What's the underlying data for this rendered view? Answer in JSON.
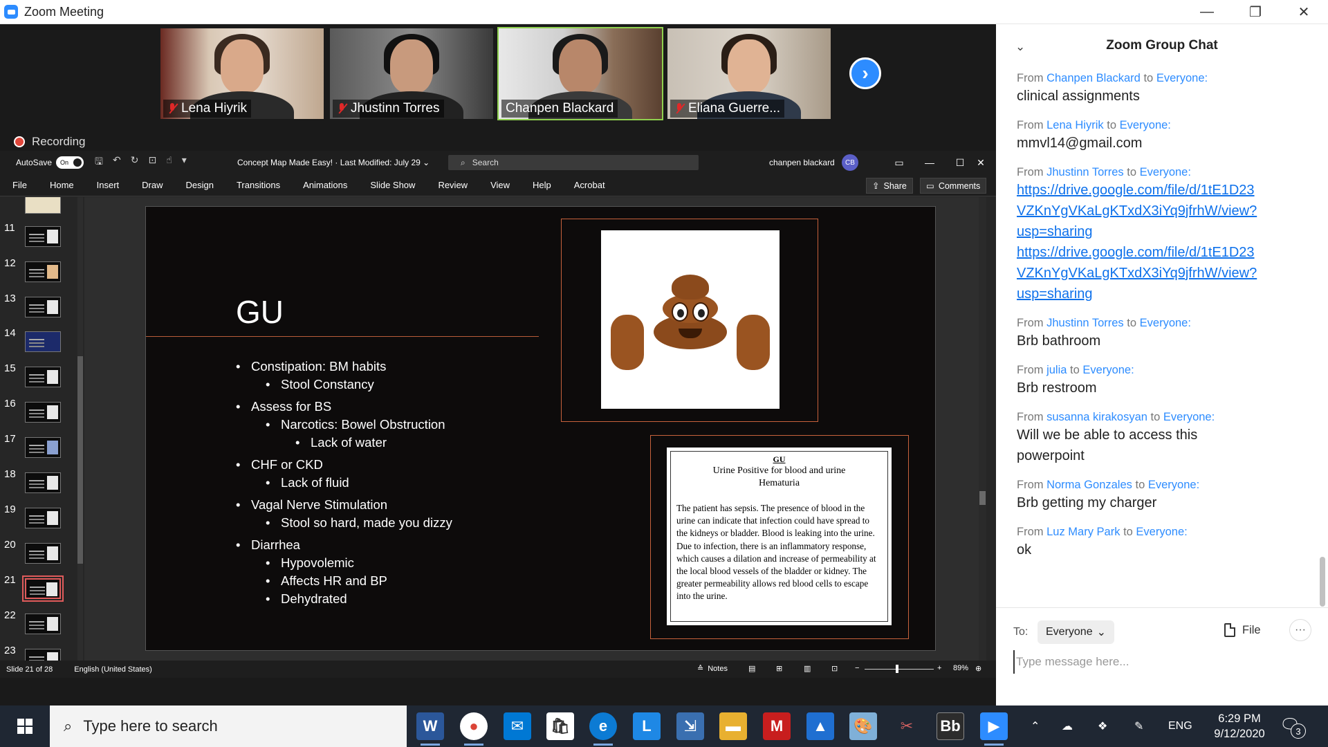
{
  "zoom_window": {
    "title": "Zoom Meeting",
    "recording_label": "Recording"
  },
  "participants": [
    {
      "name": "Lena Hiyrik",
      "muted": true
    },
    {
      "name": "Jhustinn Torres",
      "muted": true
    },
    {
      "name": "Chanpen Blackard",
      "muted": false,
      "active_speaker": true
    },
    {
      "name": "Eliana Guerre...",
      "muted": true
    }
  ],
  "powerpoint": {
    "autosave_label": "AutoSave",
    "autosave_state": "On",
    "doc_title": "Concept Map Made Easy! · Last Modified: July 29 ⌄",
    "search_placeholder": "Search",
    "user_name": "chanpen blackard",
    "user_initials": "CB",
    "ribbon_tabs": [
      "File",
      "Home",
      "Insert",
      "Draw",
      "Design",
      "Transitions",
      "Animations",
      "Slide Show",
      "Review",
      "View",
      "Help",
      "Acrobat"
    ],
    "share_label": "Share",
    "comments_label": "Comments",
    "thumbnails": [
      "11",
      "12",
      "13",
      "14",
      "15",
      "16",
      "17",
      "18",
      "19",
      "20",
      "21",
      "22",
      "23"
    ],
    "selected_slide": "21",
    "status": {
      "slide_info": "Slide 21 of 28",
      "language": "English (United States)",
      "notes_label": "Notes",
      "zoom_level": "89%"
    }
  },
  "slide": {
    "title": "GU",
    "bullets": [
      {
        "level": 1,
        "text": "Constipation: BM habits"
      },
      {
        "level": 2,
        "text": "Stool Constancy"
      },
      {
        "level": 1,
        "text": "Assess for BS"
      },
      {
        "level": 2,
        "text": "Narcotics: Bowel Obstruction"
      },
      {
        "level": 3,
        "text": "Lack of water"
      },
      {
        "level": 1,
        "text": "CHF or CKD"
      },
      {
        "level": 2,
        "text": "Lack of fluid"
      },
      {
        "level": 1,
        "text": "Vagal Nerve Stimulation"
      },
      {
        "level": 2,
        "text": "Stool so hard, made you dizzy"
      },
      {
        "level": 1,
        "text": "Diarrhea"
      },
      {
        "level": 2,
        "text": "Hypovolemic"
      },
      {
        "level": 2,
        "text": "Affects HR and BP"
      },
      {
        "level": 2,
        "text": "Dehydrated"
      }
    ],
    "doc_image": {
      "heading": "GU",
      "subtitle_1": "Urine Positive for blood and urine",
      "subtitle_2": "Hematuria",
      "body": "The patient has sepsis. The presence of blood in the urine can indicate that infection could have spread to the kidneys or bladder. Blood is leaking into the urine.  Due to infection, there is an inflammatory response, which causes a dilation and increase of permeability at the local blood vessels of the bladder or kidney.  The greater permeability allows red blood cells to escape into the urine."
    }
  },
  "chat": {
    "title": "Zoom Group Chat",
    "messages": [
      {
        "from": "Chanpen Blackard",
        "to": "Everyone:",
        "lines": [
          "clinical assignments"
        ],
        "link": false
      },
      {
        "from": "Lena Hiyrik",
        "to": "Everyone:",
        "lines": [
          "mmvl14@gmail.com"
        ],
        "link": false
      },
      {
        "from": "Jhustinn Torres",
        "to": "Everyone:",
        "lines": [
          "https://drive.google.com/file/d/1tE1D23",
          "VZKnYgVKaLgKTxdX3iYq9jfrhW/view?",
          "usp=sharing",
          "https://drive.google.com/file/d/1tE1D23",
          "VZKnYgVKaLgKTxdX3iYq9jfrhW/view?",
          "usp=sharing"
        ],
        "link": true
      },
      {
        "from": "Jhustinn Torres",
        "to": "Everyone:",
        "lines": [
          "Brb bathroom"
        ],
        "link": false
      },
      {
        "from": "julia",
        "to": "Everyone:",
        "lines": [
          "Brb restroom"
        ],
        "link": false
      },
      {
        "from": "susanna kirakosyan",
        "to": "Everyone:",
        "lines": [
          "Will we be able to access this",
          "powerpoint"
        ],
        "link": false
      },
      {
        "from": "Norma Gonzales",
        "to": "Everyone:",
        "lines": [
          "Brb getting my charger"
        ],
        "link": false
      },
      {
        "from": "Luz Mary Park",
        "to": "Everyone:",
        "lines": [
          "ok"
        ],
        "link": false
      }
    ],
    "from_word": "From",
    "to_word": "to",
    "to_label": "To:",
    "recipient": "Everyone",
    "file_label": "File",
    "input_placeholder": "Type message here..."
  },
  "taskbar": {
    "search_placeholder": "Type here to search",
    "language": "ENG",
    "time": "6:29 PM",
    "date": "9/12/2020",
    "notification_count": "3"
  }
}
